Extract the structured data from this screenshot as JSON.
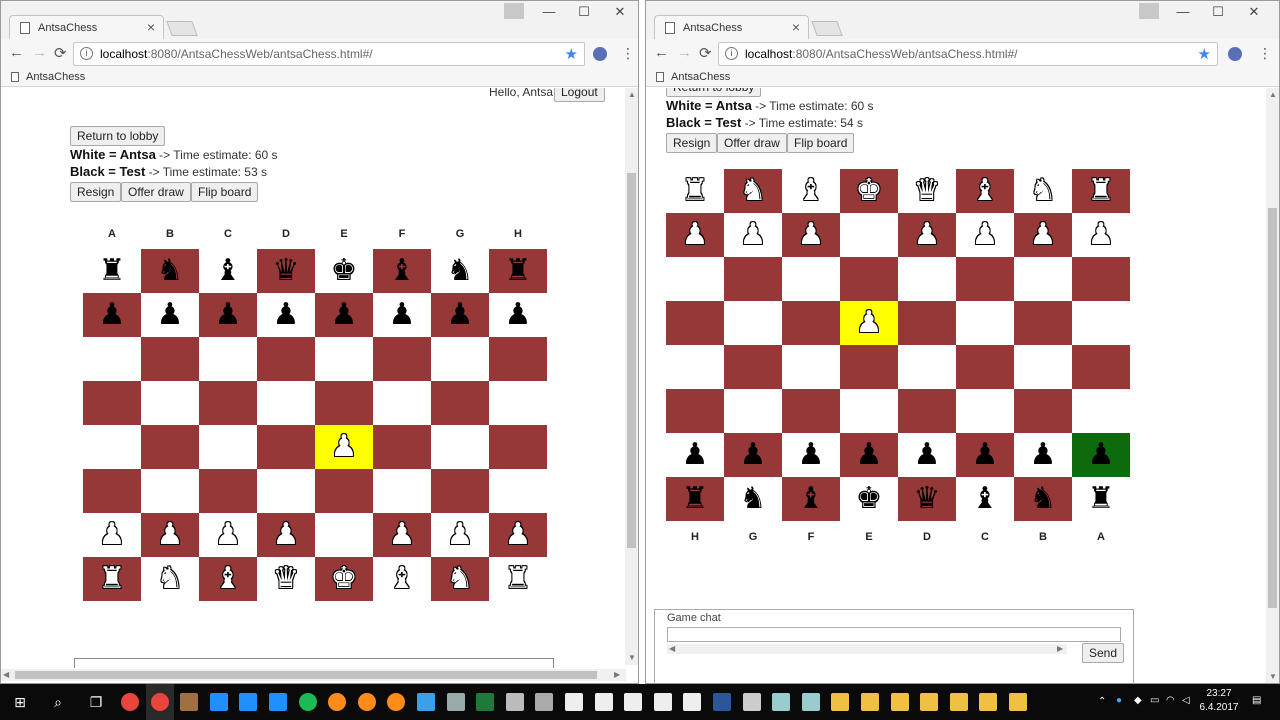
{
  "browser": {
    "tab_title": "AntsaChess",
    "tab_close": "×",
    "url_host": "localhost",
    "url_path": ":8080/AntsaChessWeb/antsaChess.html#/",
    "bookmark": "AntsaChess",
    "star": "★",
    "menu": "⋮",
    "back": "←",
    "forward": "→",
    "reload": "⟳",
    "info": "i",
    "min": "—",
    "max": "☐",
    "close": "✕"
  },
  "left": {
    "hello": "Hello, Antsa",
    "logout": "Logout",
    "return_lobby": "Return to lobby",
    "white_label": "White = Antsa",
    "white_time": " -> Time estimate: 60 s",
    "black_label": "Black = Test",
    "black_time": " -> Time estimate: 53 s",
    "resign": "Resign",
    "offer_draw": "Offer draw",
    "flip_board": "Flip board",
    "files": [
      "A",
      "B",
      "C",
      "D",
      "E",
      "F",
      "G",
      "H"
    ],
    "board": [
      [
        "br",
        "bn",
        "bb",
        "bq",
        "bk",
        "bb",
        "bn",
        "br"
      ],
      [
        "bp",
        "bp",
        "bp",
        "bp",
        "bp",
        "bp",
        "bp",
        "bp"
      ],
      [
        "",
        "",
        "",
        "",
        "",
        "",
        "",
        ""
      ],
      [
        "",
        "",
        "",
        "",
        "",
        "",
        "",
        ""
      ],
      [
        "",
        "",
        "",
        "",
        "wp",
        "",
        "",
        ""
      ],
      [
        "",
        "",
        "",
        "",
        "",
        "",
        "",
        ""
      ],
      [
        "wp",
        "wp",
        "wp",
        "wp",
        "",
        "wp",
        "wp",
        "wp"
      ],
      [
        "wr",
        "wn",
        "wb",
        "wq",
        "wk",
        "wb",
        "wn",
        "wr"
      ]
    ],
    "highlight": {
      "row": 4,
      "col": 4,
      "color": "yellow"
    }
  },
  "right": {
    "return_lobby": "Return to lobby",
    "white_label": "White = Antsa",
    "white_time": " -> Time estimate: 60 s",
    "black_label": "Black = Test",
    "black_time": " -> Time estimate: 54 s",
    "resign": "Resign",
    "offer_draw": "Offer draw",
    "flip_board": "Flip board",
    "files": [
      "H",
      "G",
      "F",
      "E",
      "D",
      "C",
      "B",
      "A"
    ],
    "board": [
      [
        "wr",
        "wn",
        "wb",
        "wk",
        "wq",
        "wb",
        "wn",
        "wr"
      ],
      [
        "wp",
        "wp",
        "wp",
        "",
        "wp",
        "wp",
        "wp",
        "wp"
      ],
      [
        "",
        "",
        "",
        "",
        "",
        "",
        "",
        ""
      ],
      [
        "",
        "",
        "",
        "wp",
        "",
        "",
        "",
        ""
      ],
      [
        "",
        "",
        "",
        "",
        "",
        "",
        "",
        ""
      ],
      [
        "",
        "",
        "",
        "",
        "",
        "",
        "",
        ""
      ],
      [
        "bp",
        "bp",
        "bp",
        "bp",
        "bp",
        "bp",
        "bp",
        "bp"
      ],
      [
        "br",
        "bn",
        "bb",
        "bk",
        "bq",
        "bb",
        "bn",
        "br"
      ]
    ],
    "highlight": {
      "row": 3,
      "col": 3,
      "color": "yellow"
    },
    "highlight2": {
      "row": 6,
      "col": 7,
      "color": "green"
    },
    "chat_title": "Game chat",
    "send": "Send"
  },
  "taskbar": {
    "time": "23:27",
    "date": "6.4.2017"
  },
  "colors": {
    "dark_square": "#963838",
    "light_square": "#ffffff",
    "highlight_yellow": "#ffff00",
    "highlight_green": "#0d6a0d"
  }
}
